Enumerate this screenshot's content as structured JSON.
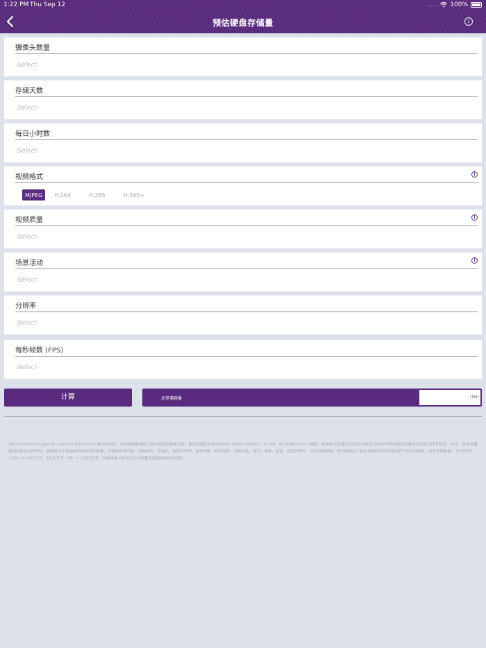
{
  "status": {
    "time": "1:22 PM",
    "date": "Thu Sep 12",
    "signal": "....",
    "battery": "100%"
  },
  "header": {
    "title": "预估硬盘存储量",
    "back_icon": "chevron-left-icon",
    "info_icon": "info-icon",
    "info_glyph": "i"
  },
  "fields": {
    "cameras": {
      "label": "摄像头数量",
      "placeholder": "-Select-"
    },
    "days": {
      "label": "存储天数",
      "placeholder": "-Select-"
    },
    "hours": {
      "label": "每日小时数",
      "placeholder": "-Select-"
    },
    "format": {
      "label": "视频格式",
      "options": [
        "MJPEG",
        "H.264",
        "H.265",
        "H.265+"
      ],
      "selected": "MJPEG"
    },
    "quality": {
      "label": "视频质量",
      "placeholder": "-Select-"
    },
    "activity": {
      "label": "场景活动",
      "placeholder": "-Select-"
    },
    "resolution": {
      "label": "分辨率",
      "placeholder": "-Select-"
    },
    "fps": {
      "label": "每秒帧数 (FPS)",
      "placeholder": "-Select-"
    }
  },
  "actions": {
    "calculate": "计算",
    "total_label": "总存储容量",
    "total_value": "",
    "unit": "(TB)*"
  },
  "disclaimer": "*此Surveillance Capacity Capacity Estimator工具仅供参考。总存储容量根据工具中选择的参数计算，典型压缩比仅由Western Digital为MJPEG、H.264、H.265和H.265 +确定，视频格式则基于30位的分辨率为4K分辨率的最高质量所有其他分辨率更高，16位。存储容量需求可能会有所不同，具体取决于连接的相机的实际数量、所需的存储天数、视频格式、压缩比、相机分辨率、每秒帧数、颜色深度、系统功能、组件、硬件、配置、设置和软件，以及其他因素。任何依赖此工具及其输出的风险均由第三方自行承担。用于存储容量，1千兆字节（GB）= 10亿字节，1兆兆字节（TB）= 1万亿字节。存储设备上的总可访问容量可能因操作环境而异。",
  "colors": {
    "brand": "#5a2a7e",
    "background": "#dce1ea"
  }
}
